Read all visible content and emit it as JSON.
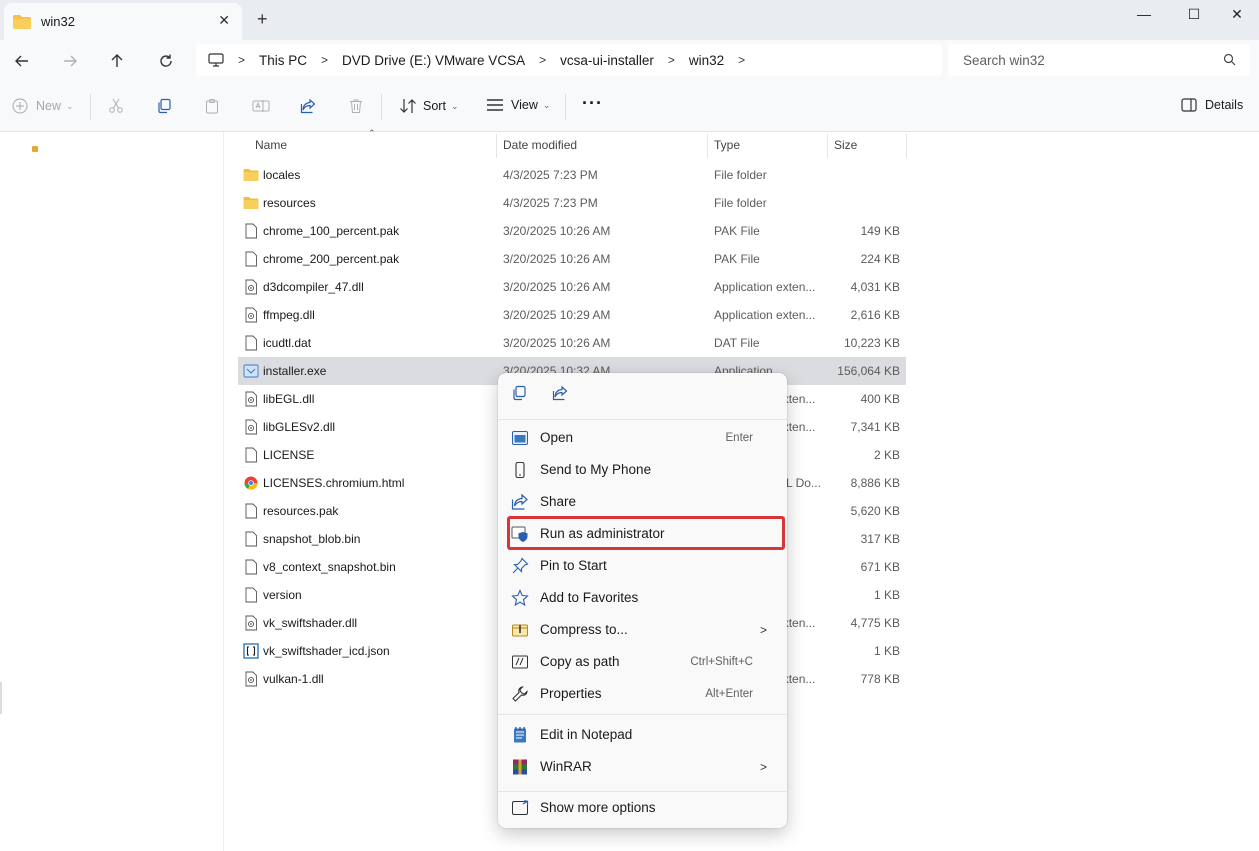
{
  "window": {
    "tab_title": "win32",
    "new_tab_symbol": "+",
    "close_tab_symbol": "✕",
    "controls": [
      "—",
      "☐",
      "✕"
    ]
  },
  "address": {
    "icon": "monitor-icon",
    "crumbs": [
      "This PC",
      "DVD Drive (E:) VMware VCSA",
      "vcsa-ui-installer",
      "win32"
    ]
  },
  "search": {
    "placeholder": "Search win32"
  },
  "commands": {
    "new_label": "New",
    "sort_label": "Sort",
    "view_label": "View",
    "more_label": "···",
    "details_label": "Details"
  },
  "columns": {
    "name": "Name",
    "date": "Date modified",
    "type": "Type",
    "size": "Size"
  },
  "files": [
    {
      "name": "locales",
      "date": "4/3/2025 7:23 PM",
      "type": "File folder",
      "size": "",
      "icon": "folder"
    },
    {
      "name": "resources",
      "date": "4/3/2025 7:23 PM",
      "type": "File folder",
      "size": "",
      "icon": "folder"
    },
    {
      "name": "chrome_100_percent.pak",
      "date": "3/20/2025 10:26 AM",
      "type": "PAK File",
      "size": "149 KB",
      "icon": "file"
    },
    {
      "name": "chrome_200_percent.pak",
      "date": "3/20/2025 10:26 AM",
      "type": "PAK File",
      "size": "224 KB",
      "icon": "file"
    },
    {
      "name": "d3dcompiler_47.dll",
      "date": "3/20/2025 10:26 AM",
      "type": "Application exten...",
      "size": "4,031 KB",
      "icon": "dll"
    },
    {
      "name": "ffmpeg.dll",
      "date": "3/20/2025 10:29 AM",
      "type": "Application exten...",
      "size": "2,616 KB",
      "icon": "dll"
    },
    {
      "name": "icudtl.dat",
      "date": "3/20/2025 10:26 AM",
      "type": "DAT File",
      "size": "10,223 KB",
      "icon": "file"
    },
    {
      "name": "installer.exe",
      "date": "3/20/2025 10:32 AM",
      "type": "Application",
      "size": "156,064 KB",
      "icon": "exe",
      "selected": true
    },
    {
      "name": "libEGL.dll",
      "date": "",
      "type": "Application exten...",
      "size": "400 KB",
      "icon": "dll"
    },
    {
      "name": "libGLESv2.dll",
      "date": "",
      "type": "Application exten...",
      "size": "7,341 KB",
      "icon": "dll"
    },
    {
      "name": "LICENSE",
      "date": "",
      "type": "",
      "size": "2 KB",
      "icon": "file"
    },
    {
      "name": "LICENSES.chromium.html",
      "date": "",
      "type": "Chrome HTML Do...",
      "size": "8,886 KB",
      "icon": "chrome"
    },
    {
      "name": "resources.pak",
      "date": "",
      "type": "",
      "size": "5,620 KB",
      "icon": "file"
    },
    {
      "name": "snapshot_blob.bin",
      "date": "",
      "type": "",
      "size": "317 KB",
      "icon": "file"
    },
    {
      "name": "v8_context_snapshot.bin",
      "date": "",
      "type": "",
      "size": "671 KB",
      "icon": "file"
    },
    {
      "name": "version",
      "date": "",
      "type": "",
      "size": "1 KB",
      "icon": "file"
    },
    {
      "name": "vk_swiftshader.dll",
      "date": "",
      "type": "Application exten...",
      "size": "4,775 KB",
      "icon": "dll"
    },
    {
      "name": "vk_swiftshader_icd.json",
      "date": "",
      "type": "",
      "size": "1 KB",
      "icon": "json"
    },
    {
      "name": "vulkan-1.dll",
      "date": "",
      "type": "Application exten...",
      "size": "778 KB",
      "icon": "dll"
    }
  ],
  "context_menu": {
    "quick_actions": [
      "copy-icon",
      "share-icon"
    ],
    "items": [
      {
        "label": "Open",
        "shortcut": "Enter",
        "icon": "open-icon",
        "submenu": false
      },
      {
        "label": "Send to My Phone",
        "shortcut": "",
        "icon": "phone-icon",
        "submenu": false
      },
      {
        "label": "Share",
        "shortcut": "",
        "icon": "share-icon",
        "submenu": false
      },
      {
        "label": "Run as administrator",
        "shortcut": "",
        "icon": "shield-icon",
        "submenu": false,
        "highlighted": true
      },
      {
        "label": "Pin to Start",
        "shortcut": "",
        "icon": "pin-icon",
        "submenu": false
      },
      {
        "label": "Add to Favorites",
        "shortcut": "",
        "icon": "star-icon",
        "submenu": false
      },
      {
        "label": "Compress to...",
        "shortcut": "",
        "icon": "zip-icon",
        "submenu": true
      },
      {
        "label": "Copy as path",
        "shortcut": "Ctrl+Shift+C",
        "icon": "path-icon",
        "submenu": false
      },
      {
        "label": "Properties",
        "shortcut": "Alt+Enter",
        "icon": "wrench-icon",
        "submenu": false
      },
      {
        "label": "Edit in Notepad",
        "shortcut": "",
        "icon": "notepad-icon",
        "submenu": false
      },
      {
        "label": "WinRAR",
        "shortcut": "",
        "icon": "winrar-icon",
        "submenu": true
      },
      {
        "label": "Show more options",
        "shortcut": "",
        "icon": "more-options-icon",
        "submenu": false
      }
    ],
    "highlight_color": "#d9343a"
  }
}
